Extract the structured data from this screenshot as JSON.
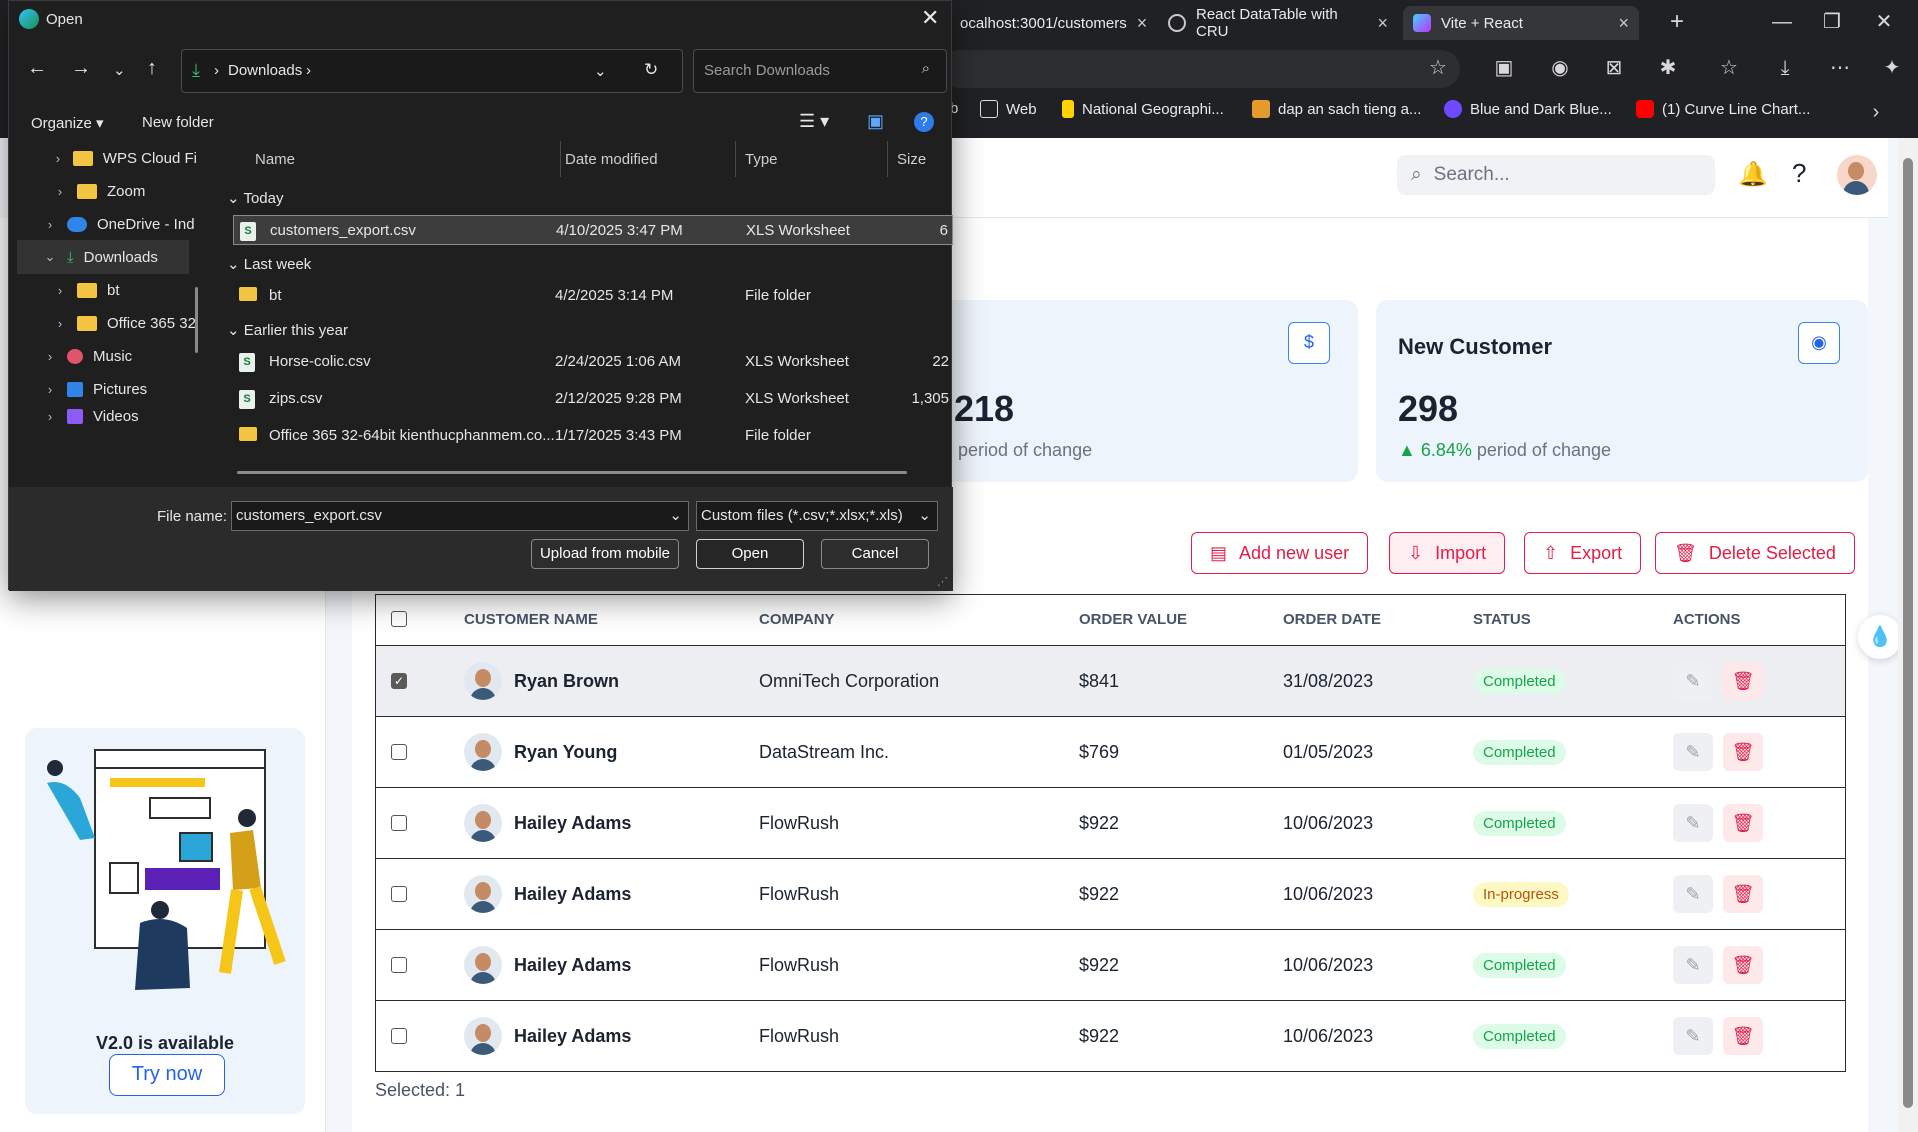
{
  "browser": {
    "tabs": [
      {
        "label": "ocalhost:3001/customers"
      },
      {
        "label": "React DataTable with CRU"
      },
      {
        "label": "Vite + React"
      }
    ],
    "bookmarks": [
      {
        "label": "b"
      },
      {
        "label": "Web"
      },
      {
        "label": "National Geographi..."
      },
      {
        "label": "dap an sach tieng a..."
      },
      {
        "label": "Blue and Dark Blue..."
      },
      {
        "label": "(1) Curve Line Chart..."
      }
    ]
  },
  "header": {
    "search_placeholder": "Search..."
  },
  "cards": [
    {
      "value": ",218",
      "change_label": "period of change"
    },
    {
      "title": "New Customer",
      "value": "298",
      "change_pct": "6.84%",
      "change_label": "period of change"
    }
  ],
  "actions": {
    "add": "Add new user",
    "import": "Import",
    "export": "Export",
    "delete": "Delete Selected"
  },
  "table": {
    "columns": [
      "CUSTOMER NAME",
      "COMPANY",
      "ORDER VALUE",
      "ORDER DATE",
      "STATUS",
      "ACTIONS"
    ],
    "rows": [
      {
        "name": "Ryan Brown",
        "company": "OmniTech Corporation",
        "value": "$841",
        "date": "31/08/2023",
        "status": "Completed",
        "checked": true
      },
      {
        "name": "Ryan Young",
        "company": "DataStream Inc.",
        "value": "$769",
        "date": "01/05/2023",
        "status": "Completed",
        "checked": false
      },
      {
        "name": "Hailey Adams",
        "company": "FlowRush",
        "value": "$922",
        "date": "10/06/2023",
        "status": "Completed",
        "checked": false
      },
      {
        "name": "Hailey Adams",
        "company": "FlowRush",
        "value": "$922",
        "date": "10/06/2023",
        "status": "In-progress",
        "checked": false
      },
      {
        "name": "Hailey Adams",
        "company": "FlowRush",
        "value": "$922",
        "date": "10/06/2023",
        "status": "Completed",
        "checked": false
      },
      {
        "name": "Hailey Adams",
        "company": "FlowRush",
        "value": "$922",
        "date": "10/06/2023",
        "status": "Completed",
        "checked": false
      }
    ],
    "selected_text": "Selected: 1"
  },
  "promo": {
    "title": "V2.0 is available",
    "button": "Try now"
  },
  "dialog": {
    "title": "Open",
    "breadcrumb": [
      "Downloads"
    ],
    "search_placeholder": "Search Downloads",
    "organize": "Organize",
    "new_folder": "New folder",
    "nav": [
      {
        "label": "WPS Cloud Fi"
      },
      {
        "label": "Zoom"
      },
      {
        "label": "OneDrive - Ind"
      },
      {
        "label": "Downloads"
      },
      {
        "label": "bt"
      },
      {
        "label": "Office 365 32"
      },
      {
        "label": "Music"
      },
      {
        "label": "Pictures"
      },
      {
        "label": "Videos"
      }
    ],
    "columns": [
      "Name",
      "Date modified",
      "Type",
      "Size"
    ],
    "groups": [
      "Today",
      "Last week",
      "Earlier this year"
    ],
    "files": [
      {
        "name": "customers_export.csv",
        "date": "4/10/2025 3:47 PM",
        "type": "XLS Worksheet",
        "size": "6"
      },
      {
        "name": "bt",
        "date": "4/2/2025 3:14 PM",
        "type": "File folder",
        "size": ""
      },
      {
        "name": "Horse-colic.csv",
        "date": "2/24/2025 1:06 AM",
        "type": "XLS Worksheet",
        "size": "22"
      },
      {
        "name": "zips.csv",
        "date": "2/12/2025 9:28 PM",
        "type": "XLS Worksheet",
        "size": "1,305"
      },
      {
        "name": "Office 365 32-64bit kienthucphanmem.co...",
        "date": "1/17/2025 3:43 PM",
        "type": "File folder",
        "size": ""
      }
    ],
    "file_name_label": "File name:",
    "file_name_value": "customers_export.csv",
    "filter": "Custom files (*.csv;*.xlsx;*.xls)",
    "upload": "Upload from mobile",
    "open": "Open",
    "cancel": "Cancel"
  }
}
